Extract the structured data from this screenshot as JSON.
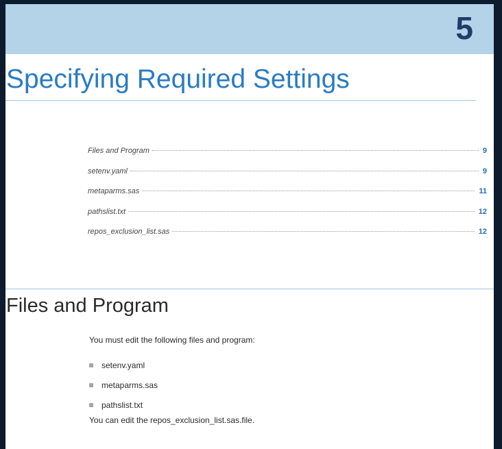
{
  "chapter": {
    "number": "5",
    "title": "Specifying Required Settings"
  },
  "toc": {
    "entries": [
      {
        "label": "Files and Program",
        "page": "9"
      },
      {
        "label": "setenv.yaml",
        "page": "9"
      },
      {
        "label": "metaparms.sas",
        "page": "11"
      },
      {
        "label": "pathslist.txt",
        "page": "12"
      },
      {
        "label": "repos_exclusion_list.sas",
        "page": "12"
      }
    ]
  },
  "section": {
    "title": "Files and Program",
    "intro": "You must edit the following files and program:",
    "bullets": [
      "setenv.yaml",
      "metaparms.sas",
      "pathslist.txt"
    ],
    "outro": "You can edit the repos_exclusion_list.sas.file."
  },
  "colors": {
    "banner": "#b4d2e8",
    "title_blue": "#2a7cc1",
    "chapter_number": "#1f3b68",
    "page_number_blue": "#1f6fb5"
  }
}
